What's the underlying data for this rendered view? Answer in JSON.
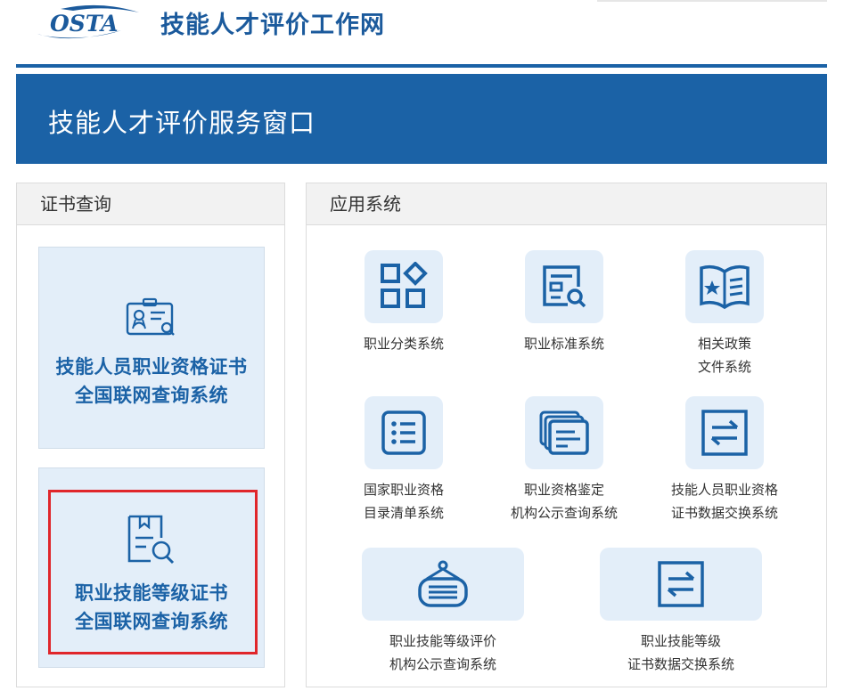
{
  "header": {
    "logo_text": "OSTA",
    "site_title": "技能人才评价工作网"
  },
  "banner": {
    "title": "技能人才评价服务窗口"
  },
  "cert_panel": {
    "title": "证书查询",
    "cards": [
      {
        "line1": "技能人员职业资格证书",
        "line2": "全国联网查询系统",
        "icon": "certificate-search-icon"
      },
      {
        "line1": "职业技能等级证书",
        "line2": "全国联网查询系统",
        "icon": "document-search-icon",
        "highlighted": true
      }
    ]
  },
  "apps_panel": {
    "title": "应用系统",
    "apps": [
      {
        "line1": "职业分类系统",
        "line2": "",
        "icon": "category-grid-icon"
      },
      {
        "line1": "职业标准系统",
        "line2": "",
        "icon": "document-search-icon"
      },
      {
        "line1": "相关政策",
        "line2": "文件系统",
        "icon": "policy-book-icon"
      },
      {
        "line1": "国家职业资格",
        "line2": "目录清单系统",
        "icon": "list-icon"
      },
      {
        "line1": "职业资格鉴定",
        "line2": "机构公示查询系统",
        "icon": "stacked-documents-icon"
      },
      {
        "line1": "技能人员职业资格",
        "line2": "证书数据交换系统",
        "icon": "exchange-icon"
      },
      {
        "line1": "职业技能等级评价",
        "line2": "机构公示查询系统",
        "icon": "hanging-sign-icon"
      },
      {
        "line1": "职业技能等级",
        "line2": "证书数据交换系统",
        "icon": "exchange-icon"
      }
    ]
  },
  "colors": {
    "brand_blue": "#1b62a6",
    "card_bg": "#e3eef9",
    "highlight_red": "#e0262b"
  }
}
